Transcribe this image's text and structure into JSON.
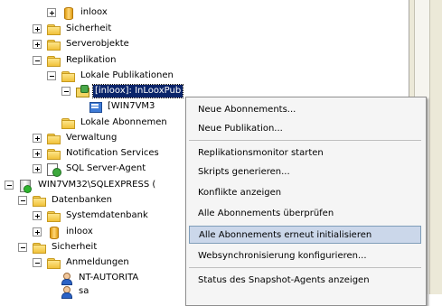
{
  "tree": {
    "items": [
      {
        "label": "inloox",
        "icon": "database-icon",
        "expander": "plus"
      },
      {
        "label": "Sicherheit",
        "icon": "folder-icon",
        "expander": "plus"
      },
      {
        "label": "Serverobjekte",
        "icon": "folder-icon",
        "expander": "plus"
      },
      {
        "label": "Replikation",
        "icon": "folder-icon",
        "expander": "minus"
      },
      {
        "label": "Lokale Publikationen",
        "icon": "folder-icon",
        "expander": "minus"
      },
      {
        "label": "[inloox]: InLooxPub",
        "icon": "publication-icon",
        "expander": "minus",
        "selected": true
      },
      {
        "label": "[WIN7VM3",
        "icon": "subscription-icon",
        "expander": "none"
      },
      {
        "label": "Lokale Abonnemen",
        "icon": "folder-icon",
        "expander": "none"
      },
      {
        "label": "Verwaltung",
        "icon": "folder-icon",
        "expander": "plus"
      },
      {
        "label": "Notification Services",
        "icon": "folder-icon",
        "expander": "plus"
      },
      {
        "label": "SQL Server-Agent",
        "icon": "agent-icon",
        "expander": "plus"
      },
      {
        "label": "WIN7VM32\\SQLEXPRESS (",
        "icon": "server-icon",
        "expander": "minus"
      },
      {
        "label": "Datenbanken",
        "icon": "folder-icon",
        "expander": "minus"
      },
      {
        "label": "Systemdatenbank",
        "icon": "folder-icon",
        "expander": "plus"
      },
      {
        "label": "inloox",
        "icon": "database-icon",
        "expander": "plus"
      },
      {
        "label": "Sicherheit",
        "icon": "folder-icon",
        "expander": "minus"
      },
      {
        "label": "Anmeldungen",
        "icon": "folder-icon",
        "expander": "minus"
      },
      {
        "label": "NT-AUTORITA",
        "icon": "user-icon",
        "expander": "none"
      },
      {
        "label": "sa",
        "icon": "user-icon",
        "expander": "none"
      }
    ]
  },
  "context_menu": {
    "items": [
      {
        "label": "Neue Abonnements..."
      },
      {
        "label": "Neue Publikation..."
      },
      {
        "label": "Replikationsmonitor starten"
      },
      {
        "label": "Skripts generieren..."
      },
      {
        "label": "Konflikte anzeigen"
      },
      {
        "label": "Alle Abonnements überprüfen"
      },
      {
        "label": "Alle Abonnements erneut initialisieren",
        "highlighted": true
      },
      {
        "label": "Websynchronisierung konfigurieren..."
      },
      {
        "label": "Status des Snapshot-Agents anzeigen"
      }
    ]
  },
  "colors": {
    "selection_bg": "#0a246a",
    "menu_highlight": "#cbd7ea",
    "folder_yellow": "#f1c23a"
  }
}
